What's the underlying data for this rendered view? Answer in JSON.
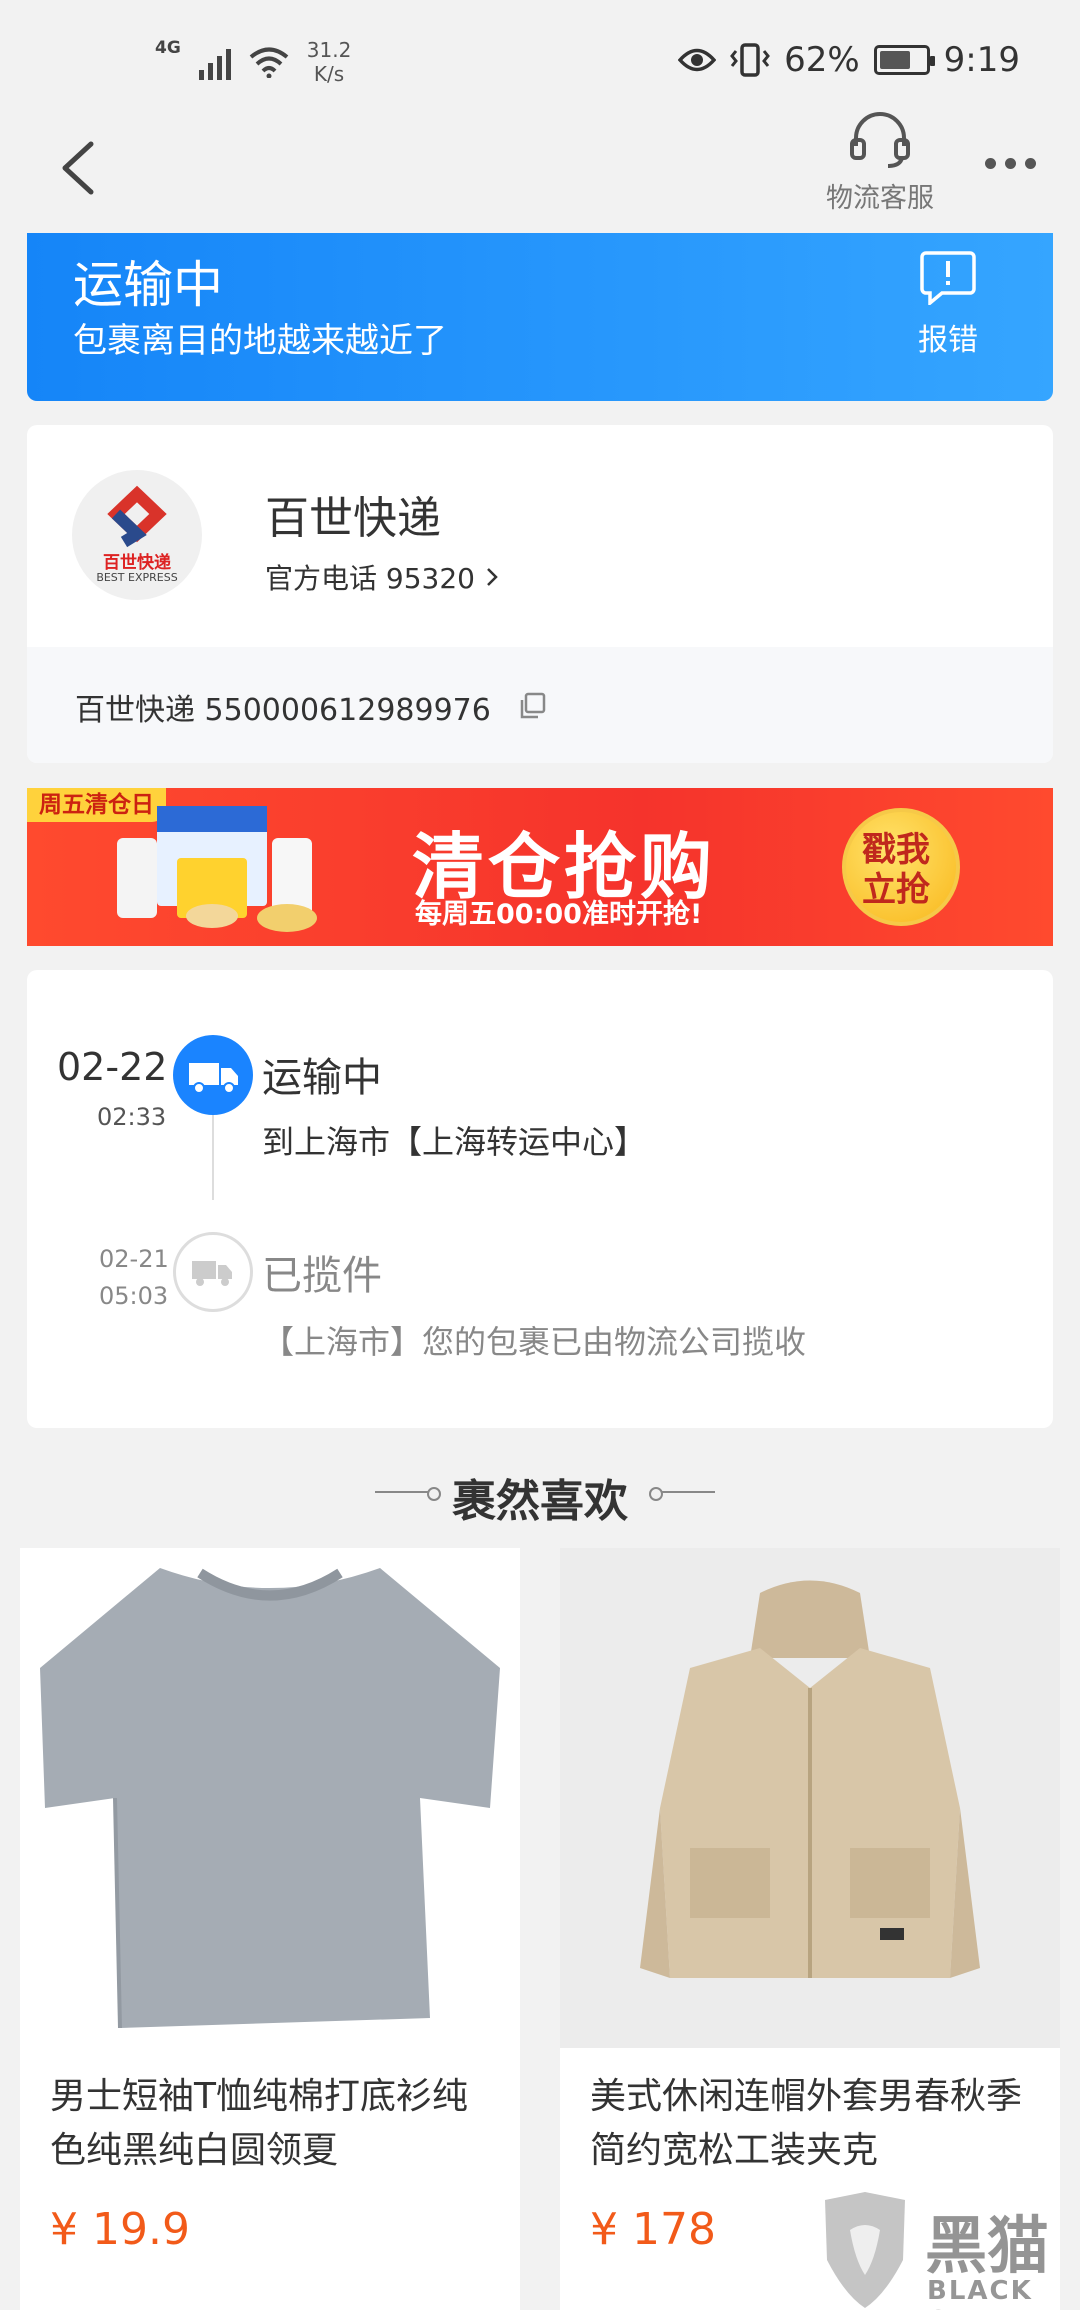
{
  "status_bar": {
    "network": "4G",
    "speed_value": "31.2",
    "speed_unit": "K/s",
    "battery": "62%",
    "time": "9:19"
  },
  "nav": {
    "service_label": "物流客服"
  },
  "shipment_status": {
    "title": "运输中",
    "subtitle": "包裹离目的地越来越近了",
    "report_label": "报错"
  },
  "courier": {
    "logo_text": "百世快递",
    "logo_subtext": "BEST EXPRESS",
    "name": "百世快递",
    "phone_label": "官方电话 95320",
    "tracking": "百世快递 550000612989976"
  },
  "promo": {
    "tag": "周五清仓日",
    "title": "清仓抢购",
    "subtitle": "每周五00:00准时开抢!",
    "button_line1": "戳我",
    "button_line2": "立抢"
  },
  "timeline": [
    {
      "date": "02-22",
      "time": "02:33",
      "status": "运输中",
      "detail": "到上海市【上海转运中心】",
      "active": true
    },
    {
      "date": "02-21",
      "time": "05:03",
      "status": "已揽件",
      "detail": "【上海市】您的包裹已由物流公司揽收",
      "active": false
    }
  ],
  "recommendations": {
    "title": "裹然喜欢",
    "items": [
      {
        "title": "男士短袖T恤纯棉打底衫纯色纯黑纯白圆领夏",
        "price": "¥ 19.9"
      },
      {
        "title": "美式休闲连帽外套男春秋季简约宽松工装夹克",
        "price": "¥ 178"
      }
    ]
  },
  "watermark": {
    "text": "黑猫",
    "sub": "BLACK CAT"
  },
  "colors": {
    "accent_blue": "#1a84ff",
    "price_orange": "#f25a19",
    "promo_red": "#f5332c"
  }
}
